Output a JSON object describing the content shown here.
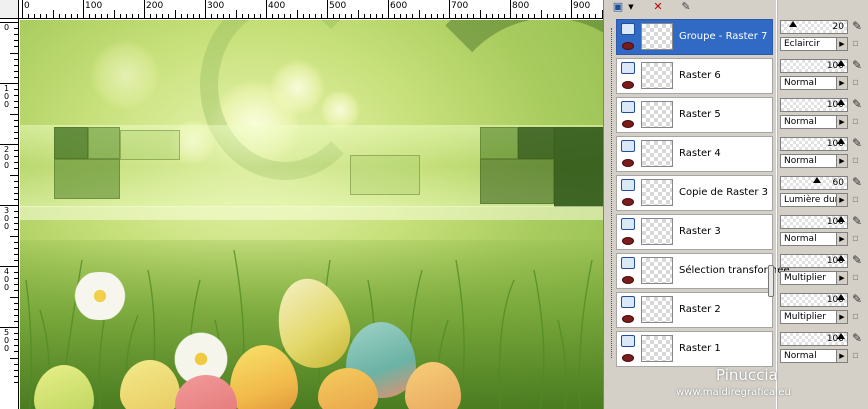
{
  "ruler": {
    "top_labels": [
      "0",
      "100",
      "200",
      "300",
      "400",
      "500",
      "600",
      "700",
      "800",
      "900"
    ],
    "left_labels": [
      "0",
      "1\n0\n0",
      "2\n0\n0",
      "3\n0\n0",
      "4\n0\n0",
      "5\n0\n0"
    ]
  },
  "layers": [
    {
      "name": "Groupe - Raster 7",
      "selected": true,
      "opacity": "20",
      "blend": "Eclaircir"
    },
    {
      "name": "Raster 6",
      "selected": false,
      "opacity": "100",
      "blend": "Normal"
    },
    {
      "name": "Raster 5",
      "selected": false,
      "opacity": "100",
      "blend": "Normal"
    },
    {
      "name": "Raster 4",
      "selected": false,
      "opacity": "100",
      "blend": "Normal"
    },
    {
      "name": "Copie de Raster 3",
      "selected": false,
      "opacity": "60",
      "blend": "Lumière dure"
    },
    {
      "name": "Raster 3",
      "selected": false,
      "opacity": "100",
      "blend": "Normal"
    },
    {
      "name": "Sélection transformée",
      "selected": false,
      "opacity": "100",
      "blend": "Multiplier"
    },
    {
      "name": "Raster 2",
      "selected": false,
      "opacity": "100",
      "blend": "Multiplier"
    },
    {
      "name": "Raster 1",
      "selected": false,
      "opacity": "100",
      "blend": "Normal"
    }
  ],
  "watermark": {
    "name": "Pinuccia",
    "site": "www.maidiregrafica.eu"
  },
  "colors": {
    "selected_row": "#316ac5",
    "panel_bg": "#d4d0c8"
  },
  "icons": {
    "toolbar": [
      "new-layer-icon",
      "chevron-down-icon",
      "delete-layer-icon",
      "edit-mask-icon"
    ],
    "row": [
      "layer-type-icon",
      "visibility-eye-icon"
    ],
    "props": [
      "pencil-icon",
      "lock-icon"
    ]
  }
}
